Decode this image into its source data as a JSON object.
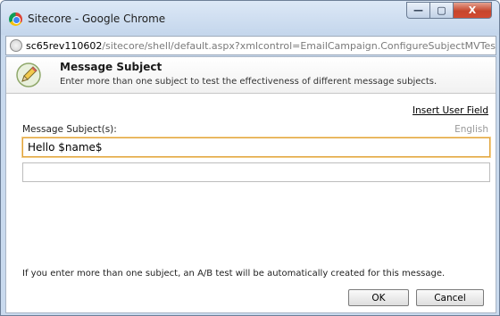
{
  "window": {
    "title": "Sitecore - Google Chrome",
    "minimize_glyph": "—",
    "maximize_glyph": "▢",
    "close_glyph": "X"
  },
  "addressbar": {
    "host": "sc65rev110602",
    "path": "/sitecore/shell/default.aspx?xmlcontrol=EmailCampaign.ConfigureSubjectMVTest&"
  },
  "dialog": {
    "title": "Message Subject",
    "subtitle": "Enter more than one subject to test the effectiveness of different message subjects.",
    "insert_field_link": "Insert User Field",
    "subjects_label": "Message Subject(s):",
    "language": "English",
    "subjects": [
      "Hello $name$",
      ""
    ],
    "footer_note": "If you enter more than one subject, an A/B test will be automatically created for this message.",
    "ok_label": "OK",
    "cancel_label": "Cancel"
  },
  "icons": {
    "window": "chrome-icon",
    "page": "globe-icon",
    "header": "pencil-icon"
  }
}
